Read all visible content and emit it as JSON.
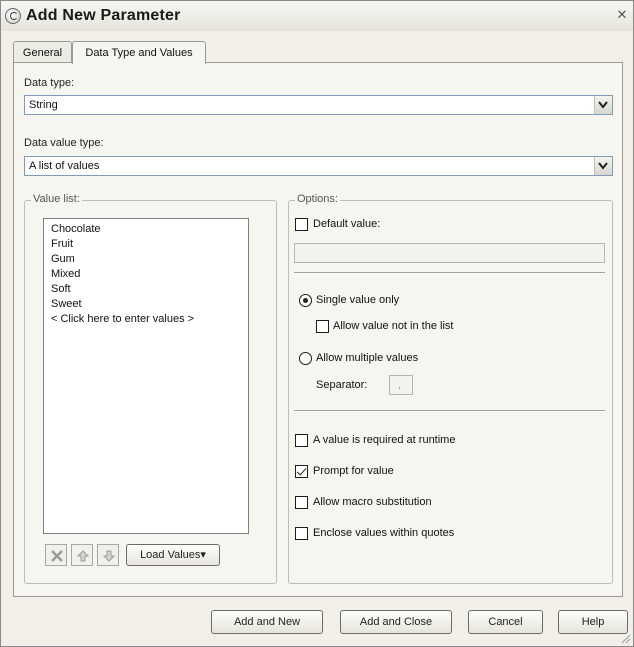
{
  "window": {
    "title": "Add New Parameter",
    "close_glyph": "✕"
  },
  "tabs": [
    {
      "label": "General"
    },
    {
      "label": "Data Type and Values"
    }
  ],
  "data_type": {
    "label": "Data type:",
    "value": "String"
  },
  "data_value_type": {
    "label": "Data value type:",
    "value": "A list of values"
  },
  "value_list": {
    "legend": "Value list:",
    "items": [
      "Chocolate",
      "Fruit",
      "Gum",
      "Mixed",
      "Soft",
      "Sweet",
      "< Click here to enter values >"
    ],
    "load_values_label": "Load Values▾"
  },
  "options": {
    "legend": "Options:",
    "default_value": {
      "label": "Default value:",
      "checked": false,
      "value": ""
    },
    "single_value": {
      "label": "Single value only",
      "selected": true
    },
    "allow_not_in_list": {
      "label": "Allow value not in the list",
      "checked": false
    },
    "multiple_values": {
      "label": "Allow multiple values",
      "selected": false
    },
    "separator": {
      "label": "Separator:",
      "value": ","
    },
    "required_at_runtime": {
      "label": "A value is required at runtime",
      "checked": false
    },
    "prompt_for_value": {
      "label": "Prompt for value",
      "checked": true
    },
    "macro_substitution": {
      "label": "Allow macro substitution",
      "checked": false
    },
    "enclose_quotes": {
      "label": "Enclose values within quotes",
      "checked": false
    }
  },
  "footer": {
    "add_and_new": "Add and New",
    "add_and_close": "Add and Close",
    "cancel": "Cancel",
    "help": "Help"
  }
}
